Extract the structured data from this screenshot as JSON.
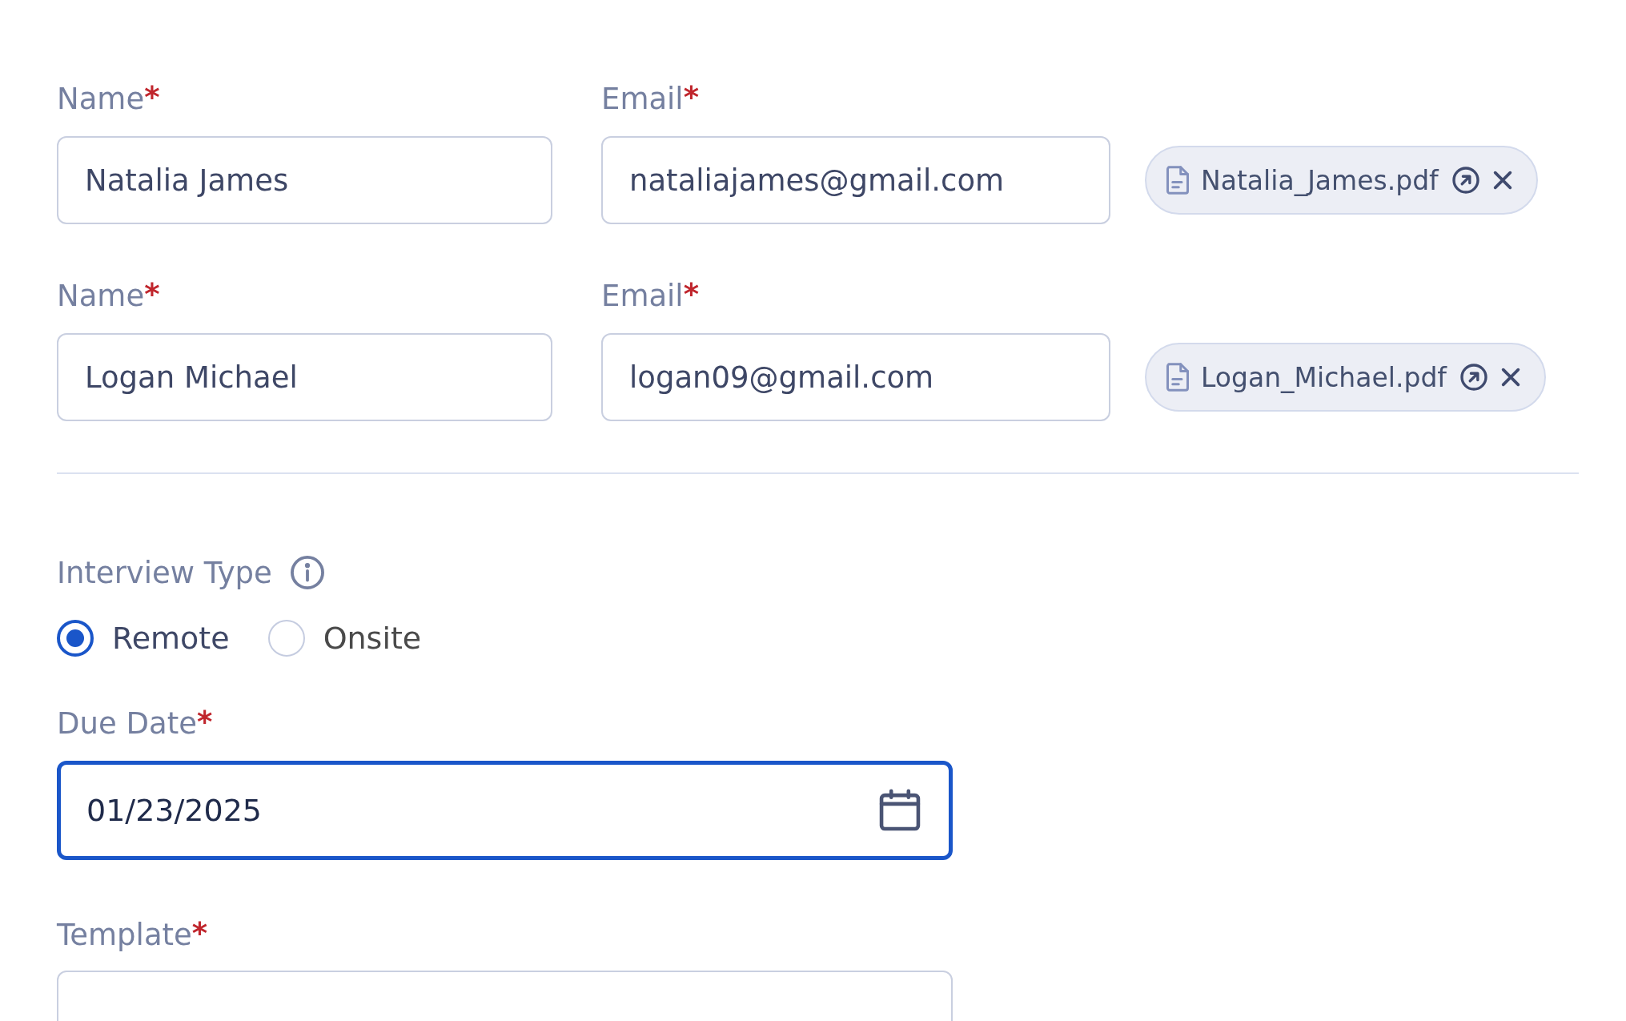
{
  "applicants": [
    {
      "name_field": {
        "label": "Name",
        "required_mark": "*",
        "value": "Natalia James"
      },
      "email_field": {
        "label": "Email",
        "required_mark": "*",
        "value": "nataliajames@gmail.com"
      },
      "attachment": {
        "file_name": "Natalia_James.pdf"
      }
    },
    {
      "name_field": {
        "label": "Name",
        "required_mark": "*",
        "value": "Logan Michael"
      },
      "email_field": {
        "label": "Email",
        "required_mark": "*",
        "value": "logan09@gmail.com"
      },
      "attachment": {
        "file_name": "Logan_Michael.pdf"
      }
    }
  ],
  "interview_type": {
    "label": "Interview Type",
    "options": [
      {
        "label": "Remote",
        "selected": true
      },
      {
        "label": "Onsite",
        "selected": false
      }
    ]
  },
  "due_date": {
    "label": "Due Date",
    "required_mark": "*",
    "value": "01/23/2025",
    "focused": true
  },
  "template": {
    "label": "Template",
    "required_mark": "*"
  }
}
